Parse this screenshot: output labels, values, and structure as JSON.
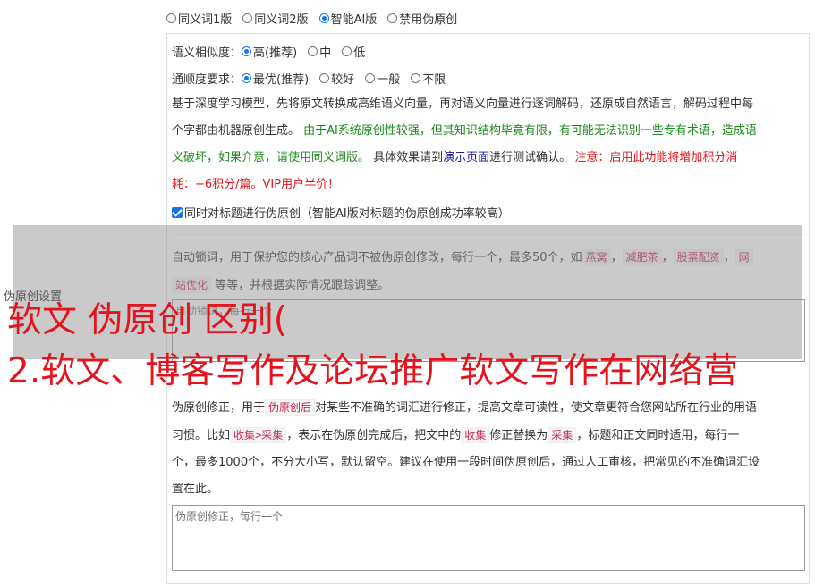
{
  "mode_options": [
    {
      "label": "同义词1版",
      "selected": false
    },
    {
      "label": "同义词2版",
      "selected": false
    },
    {
      "label": "智能AI版",
      "selected": true
    },
    {
      "label": "禁用伪原创",
      "selected": false
    }
  ],
  "similarity": {
    "label": "语义相似度：",
    "options": [
      {
        "label": "高(推荐)",
        "selected": true
      },
      {
        "label": "中",
        "selected": false
      },
      {
        "label": "低",
        "selected": false
      }
    ]
  },
  "fluency": {
    "label": "通顺度要求：",
    "options": [
      {
        "label": "最优(推荐)",
        "selected": true
      },
      {
        "label": "较好",
        "selected": false
      },
      {
        "label": "一般",
        "selected": false
      },
      {
        "label": "不限",
        "selected": false
      }
    ]
  },
  "description": {
    "line1": "基于深度学习模型，先将原文转换成高维语义向量，再对语义向量进行逐词解码，还原成自然语言，解码过程中每",
    "line2_black": "个字都由机器原创生成。 ",
    "line2_green": "由于AI系统原创性较强，但其知识结构毕竟有限，有可能无法识别一些专有术语，造成语",
    "line3_green": "义破坏，如果介意，请使用同义词版。",
    "line3_black1": " 具体效果请到",
    "line3_link": "演示页面",
    "line3_black2": "进行测试确认。 ",
    "line3_red": "注意：启用此功能将增加积分消",
    "line4_red": "耗：+6积分/篇。VIP用户半价！"
  },
  "title_checkbox": {
    "label": "同时对标题进行伪原创（智能AI版对标题的伪原创成功率较高）",
    "checked": true
  },
  "lock_words": {
    "text1": "自动锁词，用于保护您的核心产品词不被伪原创修改，每行一个，最多50个，如",
    "tag1": "燕窝",
    "tag2": "减肥茶",
    "tag3": "股票配资",
    "tag4a": "网",
    "tag4b": "站优化",
    "text2": "等等，并根据实际情况跟踪调整。",
    "placeholder": "自动锁词，每行一个"
  },
  "correction": {
    "line1a": "伪原创修正，用于",
    "tag1": "伪原创后",
    "line1b": "对某些不准确的词汇进行修正，提高文章可读性，使文章更符合您网站所在行业的用语",
    "line2a": "习惯。比如",
    "tag2": "收集>采集",
    "line2b": "，表示在伪原创完成后，把文中的",
    "tag3": "收集",
    "line2c": "修正替换为",
    "tag4": "采集",
    "line2d": "，标题和正文同时适用，每行一",
    "line3": "个，最多1000个，不分大小写，默认留空。建议在使用一段时间伪原创后，通过人工审核，把常见的不准确词汇设",
    "line4": "置在此。",
    "placeholder": "伪原创修正，每行一个"
  },
  "side_label": "伪原创设置",
  "overlay_title": {
    "line1": "软文 伪原创 区别(",
    "line2": "2.软文、博客写作及论坛推广软文写作在网络营"
  }
}
